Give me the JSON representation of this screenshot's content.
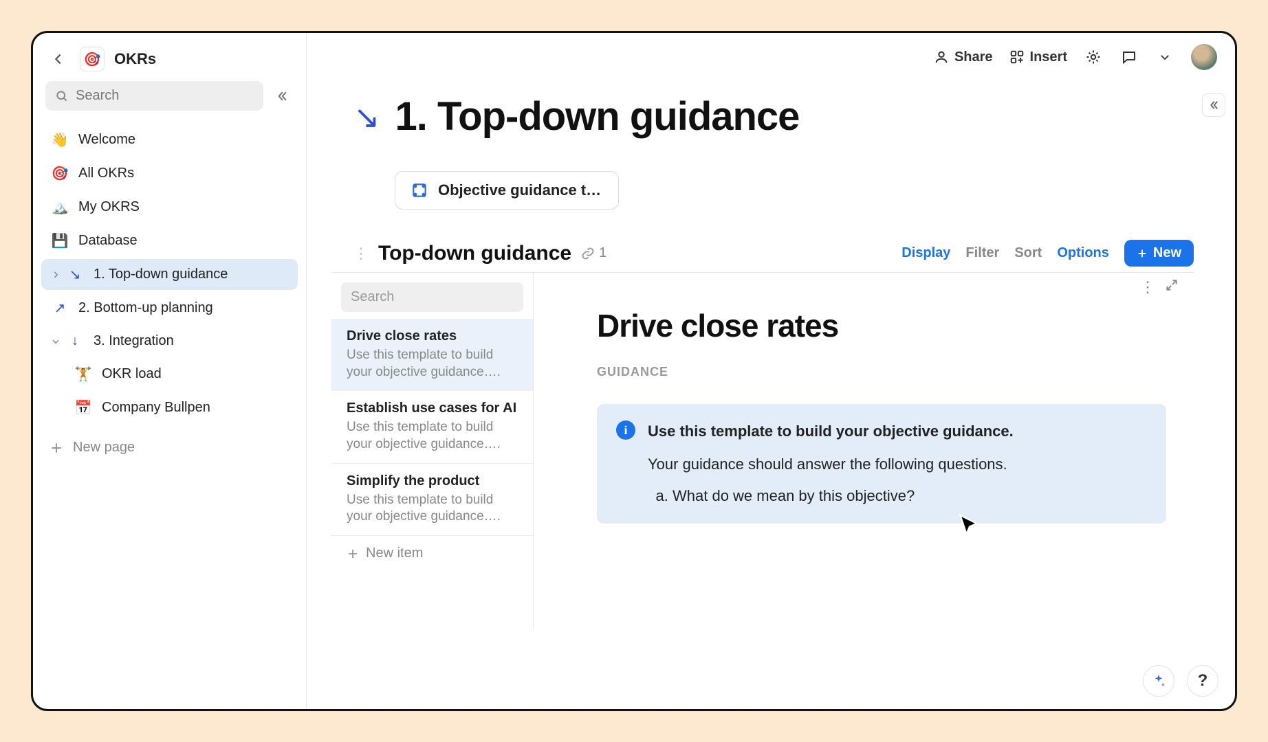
{
  "workspace": {
    "icon": "🎯",
    "name": "OKRs"
  },
  "search": {
    "placeholder": "Search"
  },
  "nav": {
    "items": [
      {
        "icon": "👋",
        "label": "Welcome"
      },
      {
        "icon": "🎯",
        "label": "All OKRs"
      },
      {
        "icon": "🏔️",
        "label": "My OKRS"
      },
      {
        "icon": "💾",
        "label": "Database"
      },
      {
        "icon": "↘️",
        "label": "1. Top-down guidance",
        "selected": true,
        "expandable": true
      },
      {
        "icon": "↗️",
        "label": "2. Bottom-up planning"
      },
      {
        "icon": "⬇️",
        "label": "3. Integration",
        "expanded": true
      },
      {
        "icon": "🏋️",
        "label": "OKR load",
        "sub": true
      },
      {
        "icon": "📅",
        "label": "Company Bullpen",
        "sub": true
      }
    ],
    "new_page": "New page"
  },
  "topbar": {
    "share": "Share",
    "insert": "Insert"
  },
  "page": {
    "title": "1. Top-down guidance",
    "template_chip": "Objective guidance te…"
  },
  "db": {
    "title": "Top-down guidance",
    "link_count": "1",
    "tools": {
      "display": "Display",
      "filter": "Filter",
      "sort": "Sort",
      "options": "Options",
      "new": "New"
    },
    "search_placeholder": "Search",
    "rows": [
      {
        "title": "Drive close rates",
        "desc": "Use this template to build your objective guidance…."
      },
      {
        "title": "Establish use cases for AI",
        "desc": "Use this template to build your objective guidance…."
      },
      {
        "title": "Simplify the product",
        "desc": "Use this template to build your objective guidance…."
      }
    ],
    "new_item": "New item"
  },
  "detail": {
    "title": "Drive close rates",
    "section_label": "GUIDANCE",
    "callout_title": "Use this template to build your objective guidance.",
    "callout_body": "Your guidance should answer the following questions.",
    "callout_q1": "What do we mean by this objective?"
  }
}
